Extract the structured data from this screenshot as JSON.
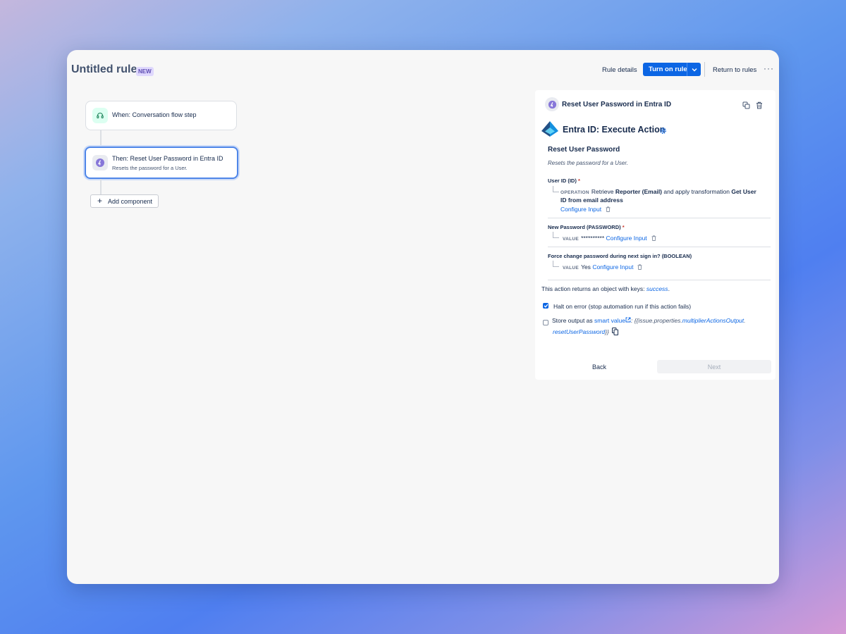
{
  "header": {
    "title": "Untitled rule",
    "badge": "NEW",
    "rule_details": "Rule details",
    "turn_on": "Turn on rule",
    "return": "Return to rules",
    "more": "···"
  },
  "flow": {
    "trigger": {
      "label": "When: Conversation flow step",
      "icon": "headset-icon"
    },
    "action": {
      "label": "Then: Reset User Password in Entra ID",
      "sub": "Resets the password for a User.",
      "icon": "entra-icon"
    },
    "add_component": "Add component"
  },
  "panel": {
    "title": "Reset User Password in Entra ID",
    "service_title": "Entra ID: Execute Action",
    "action_title": "Reset User Password",
    "action_desc": "Resets the password for a User.",
    "fields": [
      {
        "label": "User ID (ID)",
        "required": "*",
        "kind": "OPERATION",
        "text_a": "Retrieve",
        "bold_a": "Reporter (Email)",
        "text_b": "and apply transformation",
        "bold_b": "Get User",
        "bold_c": "ID from email address",
        "link": "Configure Input"
      },
      {
        "label": "New Password (PASSWORD)",
        "required": "*",
        "kind": "VALUE",
        "value": "**********",
        "link": "Configure Input"
      },
      {
        "label": "Force change password during next sign in? (BOOLEAN)",
        "kind": "VALUE",
        "value": "Yes",
        "link": "Configure Input"
      }
    ],
    "returns_prefix": "This action returns an object with keys:",
    "returns_key": "success",
    "halt_label": "Halt on error (stop automation run if this action fails)",
    "halt_checked": true,
    "store_prefix": "Store output as",
    "smart_value_link": "smart value",
    "smart_prefix": ": {{issue.properties.",
    "smart_part1": "multiplierActionsOutput",
    "smart_dot": ".",
    "smart_part2": "resetUserPassword",
    "smart_suffix": "}}",
    "store_checked": false,
    "back": "Back",
    "next": "Next"
  },
  "colors": {
    "accent": "#0c66e4",
    "selected_border": "#4f86e8",
    "badge_bg": "#dfd8fd",
    "badge_text": "#5e4db2",
    "required": "#c9372c"
  }
}
